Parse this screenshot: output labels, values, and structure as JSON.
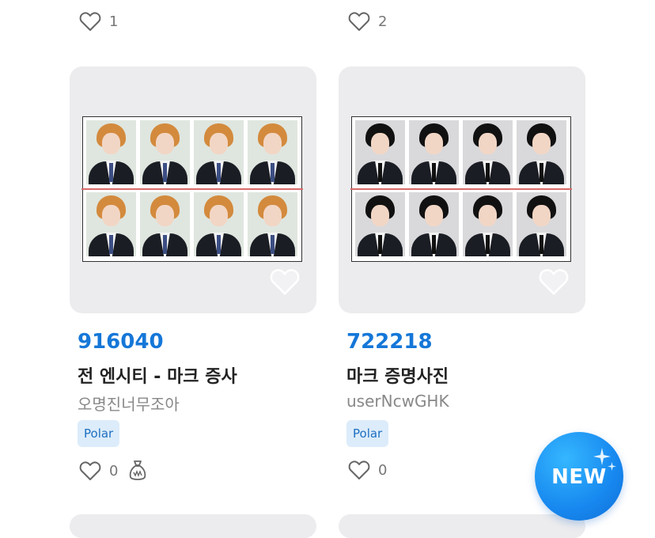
{
  "top_row": {
    "left_likes": "1",
    "right_likes": "2"
  },
  "products": [
    {
      "price": "916040",
      "title": "전 엔시티 - 마크 증사",
      "seller": "오명진너무조아",
      "tag": "Polar",
      "likes": "0",
      "hair_color": "#d38a3d",
      "tie_style": "blue"
    },
    {
      "price": "722218",
      "title": "마크 증명사진",
      "seller": "userNcwGHK",
      "tag": "Polar",
      "likes": "0",
      "hair_color": "#111111",
      "tie_style": "dark"
    }
  ],
  "new_badge": {
    "label": "NEW"
  },
  "colors": {
    "accent": "#1577d8",
    "tag_bg": "#dcecfa",
    "card_bg": "#ececee"
  }
}
